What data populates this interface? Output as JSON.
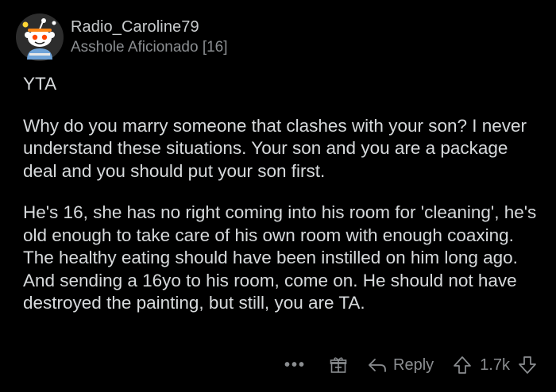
{
  "comment": {
    "author": {
      "username": "Radio_Caroline79",
      "flair": "Asshole Aficionado [16]",
      "avatar_icon": "snoo-avatar-icon"
    },
    "verdict": "YTA",
    "paragraphs": [
      "Why do you marry someone that clashes with your son? I never understand these situations. Your son and you are a package deal and you should put your son first.",
      "He's 16, she has no right coming into his room for 'cleaning', he's old enough to take care of his own room with enough coaxing. The healthy eating should have been instilled on him long ago. And sending a 16yo to his room, come on. He should not have destroyed the painting, but still, you are TA."
    ],
    "actions": {
      "more_label": "•••",
      "award_icon": "gift-icon",
      "reply_label": "Reply",
      "reply_icon": "reply-arrow-icon",
      "upvote_icon": "upvote-arrow-icon",
      "score": "1.7k",
      "downvote_icon": "downvote-arrow-icon"
    }
  },
  "colors": {
    "background": "#000000",
    "text": "#d7dadc",
    "meta": "#8b8e91",
    "avatar_bg": "#2d2d2d"
  }
}
